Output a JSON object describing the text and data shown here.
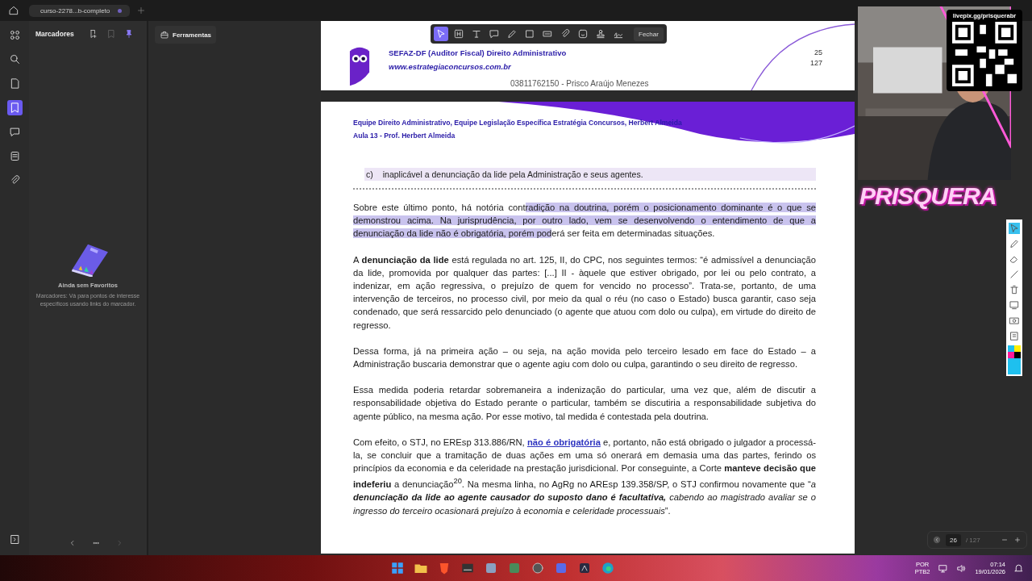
{
  "tab": {
    "title": "curso-2278...b-completo"
  },
  "rail": [
    {
      "kind": "apps",
      "selected": false
    },
    {
      "kind": "search",
      "selected": false
    },
    {
      "kind": "page",
      "selected": false
    },
    {
      "kind": "bookmark",
      "selected": true
    },
    {
      "kind": "comment",
      "selected": false
    },
    {
      "kind": "stack",
      "selected": false
    },
    {
      "kind": "attach",
      "selected": false
    }
  ],
  "sidebar": {
    "title": "Marcadores",
    "empty_title": "Ainda sem Favoritos",
    "empty_text": "Marcadores: Vá para pontos de interesse específicos usando links do marcador."
  },
  "tools_button": "Ferramentas",
  "annotation_toolbar": {
    "tools": [
      {
        "kind": "select",
        "selected": true
      },
      {
        "kind": "heading",
        "selected": false
      },
      {
        "kind": "text",
        "selected": false
      },
      {
        "kind": "comment",
        "selected": false
      },
      {
        "kind": "pen",
        "selected": false
      },
      {
        "kind": "shape",
        "selected": false
      },
      {
        "kind": "redact",
        "selected": false
      },
      {
        "kind": "attach",
        "selected": false
      },
      {
        "kind": "sticker",
        "selected": false
      },
      {
        "kind": "stamp",
        "selected": false
      },
      {
        "kind": "signature",
        "selected": false
      }
    ],
    "close": "Fechar"
  },
  "page_header": {
    "course": "SEFAZ-DF (Auditor Fiscal) Direito Administrativo",
    "site": "www.estrategiaconcursos.com.br",
    "page": "25",
    "total": "127",
    "owner": "03811762150 - Prisco Araújo Menezes"
  },
  "page_banner": {
    "team": "Equipe Direito Administrativo, Equipe Legislação Específica Estratégia Concursos, Herbert Almeida",
    "lesson": "Aula 13 - Prof. Herbert Almeida"
  },
  "option": {
    "letter": "c)",
    "text": "inaplicável a denunciação da lide pela Administração e seus agentes."
  },
  "paragraphs": [
    {
      "segments": [
        {
          "kind": "text",
          "text": "Sobre este último ponto, há notória cont"
        },
        {
          "kind": "highlight",
          "text": "radição na doutrina, porém o posicionamento dominante é o que se demonstrou acima. Na jurisprudência, por outro lado, vem se desenvolvendo o entendimento de que a denunciação da lide não é obrigatória, porém pod"
        },
        {
          "kind": "text",
          "text": "erá ser feita em determinadas situações."
        }
      ]
    },
    {
      "segments": [
        {
          "kind": "text",
          "text": "A **denunciação da lide** está regulada no art. 125, II, do CPC, nos seguintes termos: “é admissível a denunciação da lide, promovida por qualquer das partes: [...] II - àquele que estiver obrigado, por lei ou pelo contrato, a indenizar, em ação regressiva, o prejuízo de quem for vencido no processo”. Trata-se, portanto, de uma intervenção de terceiros, no processo civil, por meio da qual o réu (no caso o Estado) busca garantir, caso seja condenado, que será ressarcido pelo denunciado (o agente que atuou com dolo ou culpa), em virtude do direito de regresso."
        }
      ]
    },
    {
      "segments": [
        {
          "kind": "text",
          "text": "Dessa forma, já na primeira ação – ou seja, na ação movida pelo terceiro lesado em face do Estado – a Administração buscaria demonstrar que o agente agiu com dolo ou culpa, garantindo o seu direito de regresso."
        }
      ]
    },
    {
      "segments": [
        {
          "kind": "text",
          "text": "Essa medida poderia retardar sobremaneira a indenização do particular, uma vez que, além de discutir a responsabilidade objetiva do Estado perante o particular, também se discutiria a responsabilidade subjetiva do agente público, na mesma ação. Por esse motivo, tal medida é contestada pela doutrina."
        }
      ]
    },
    {
      "segments": [
        {
          "kind": "text",
          "text": "Com efeito, o STJ, no EREsp 313.886/RN, "
        },
        {
          "kind": "link",
          "text": "não é obrigatória"
        },
        {
          "kind": "text",
          "text": " e, portanto, não está obrigado o julgador a processá-la, se concluir que a tramitação de duas ações em uma só onerará em demasia uma das partes, ferindo os princípios da economia e da celeridade na prestação jurisdicional. Por conseguinte, a Corte **manteve decisão que indeferiu** a denunciação$^{20}$. Na mesma linha, no AgRg no AREsp 139.358/SP, o STJ confirmou novamente que “"
        },
        {
          "kind": "italic",
          "text": "a **denunciação da lide ao agente causador do suposto dano é facultativa,** cabendo ao magistrado avaliar se o ingresso do terceiro ocasionará prejuízo à economia e celeridade processuais"
        },
        {
          "kind": "text",
          "text": "”."
        }
      ]
    }
  ],
  "page_nav": {
    "page": "26",
    "total": "/ 127"
  },
  "stream_overlay": {
    "qr_caption": "livepix.gg/prisquerabr",
    "logo": "PRISQUERA"
  },
  "taskbar": {
    "language": "POR",
    "layout": "PTB2",
    "time": "07:14",
    "date": "19/01/2026"
  }
}
